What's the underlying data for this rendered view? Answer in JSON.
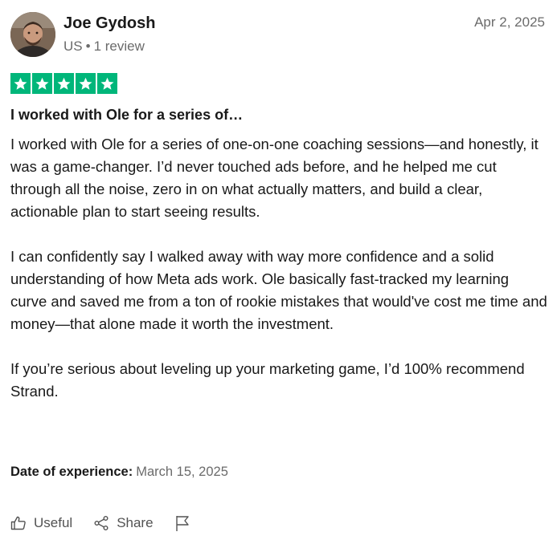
{
  "reviewer": {
    "name": "Joe Gydosh",
    "country": "US",
    "separator": "•",
    "review_count": "1 review",
    "avatar_icon": "user-avatar-photo"
  },
  "review": {
    "date": "Apr 2, 2025",
    "rating": 5,
    "rating_max": 5,
    "star_color": "#00b67a",
    "title": "I worked with Ole for a series of…",
    "body": [
      "I worked with Ole for a series of one-on-one coaching sessions—and honestly, it was a game-changer. I’d never touched ads before, and he helped me cut through all the noise, zero in on what actually matters, and build a clear, actionable plan to start seeing results.",
      "I can confidently say I walked away with way more confidence and a solid understanding of how Meta ads work. Ole basically fast-tracked my learning curve and saved me from a ton of rookie mistakes that would've cost me time and money—that alone made it worth the investment.",
      "If you’re serious about leveling up your marketing game, I’d 100% recommend Strand."
    ],
    "experience_label": "Date of experience:",
    "experience_date": "March 15, 2025"
  },
  "actions": {
    "useful_label": "Useful",
    "useful_icon": "thumbs-up-icon",
    "share_label": "Share",
    "share_icon": "share-icon",
    "report_icon": "flag-icon"
  }
}
